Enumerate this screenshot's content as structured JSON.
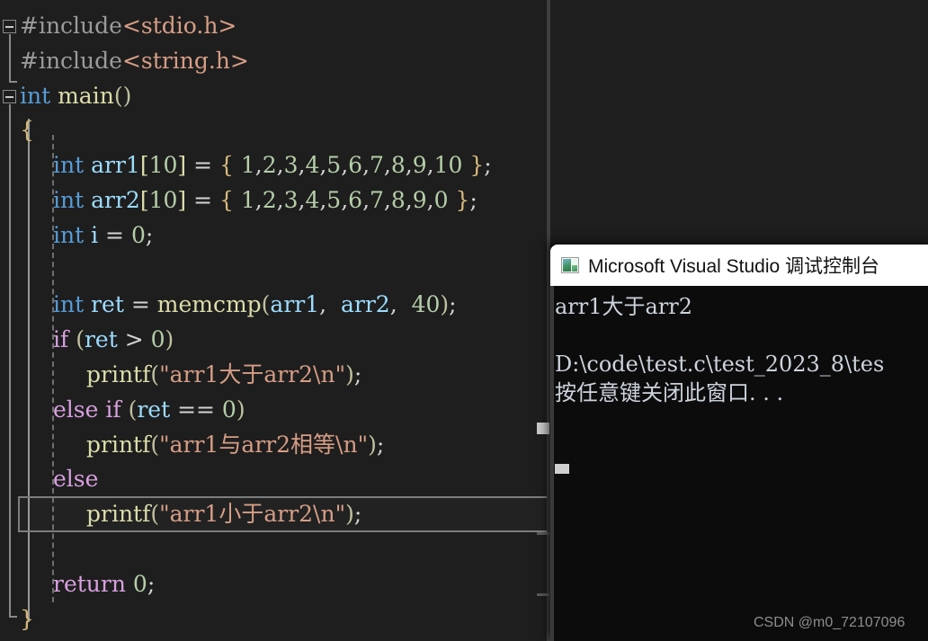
{
  "editor": {
    "language": "c",
    "background_color": "#1e1e1e",
    "highlight_border_color": "#7d7d7d",
    "lines": [
      {
        "n": 1,
        "indent": 0,
        "segments": [
          {
            "text": "#include",
            "cls": "t-pre"
          },
          {
            "text": "<stdio.h>",
            "cls": "t-hdr"
          }
        ]
      },
      {
        "n": 2,
        "indent": 0,
        "segments": [
          {
            "text": "#include",
            "cls": "t-pre"
          },
          {
            "text": "<string.h>",
            "cls": "t-hdr"
          }
        ]
      },
      {
        "n": 3,
        "indent": 0,
        "segments": [
          {
            "text": "int ",
            "cls": "t-kw"
          },
          {
            "text": "main",
            "cls": "t-fn"
          },
          {
            "text": "()",
            "cls": "t-paren"
          }
        ]
      },
      {
        "n": 4,
        "indent": 0,
        "segments": [
          {
            "text": "{",
            "cls": "t-brace"
          }
        ]
      },
      {
        "n": 5,
        "indent": 1,
        "segments": [
          {
            "text": "int ",
            "cls": "t-kw"
          },
          {
            "text": "arr1",
            "cls": "t-var"
          },
          {
            "text": "[",
            "cls": "t-brk"
          },
          {
            "text": "10",
            "cls": "t-num"
          },
          {
            "text": "]",
            "cls": "t-brk"
          },
          {
            "text": " = ",
            "cls": "t-pun"
          },
          {
            "text": "{ ",
            "cls": "t-brace"
          },
          {
            "text": "1",
            "cls": "t-num"
          },
          {
            "text": ",",
            "cls": "t-pun"
          },
          {
            "text": "2",
            "cls": "t-num"
          },
          {
            "text": ",",
            "cls": "t-pun"
          },
          {
            "text": "3",
            "cls": "t-num"
          },
          {
            "text": ",",
            "cls": "t-pun"
          },
          {
            "text": "4",
            "cls": "t-num"
          },
          {
            "text": ",",
            "cls": "t-pun"
          },
          {
            "text": "5",
            "cls": "t-num"
          },
          {
            "text": ",",
            "cls": "t-pun"
          },
          {
            "text": "6",
            "cls": "t-num"
          },
          {
            "text": ",",
            "cls": "t-pun"
          },
          {
            "text": "7",
            "cls": "t-num"
          },
          {
            "text": ",",
            "cls": "t-pun"
          },
          {
            "text": "8",
            "cls": "t-num"
          },
          {
            "text": ",",
            "cls": "t-pun"
          },
          {
            "text": "9",
            "cls": "t-num"
          },
          {
            "text": ",",
            "cls": "t-pun"
          },
          {
            "text": "10",
            "cls": "t-num"
          },
          {
            "text": " }",
            "cls": "t-brace"
          },
          {
            "text": ";",
            "cls": "t-pun"
          }
        ]
      },
      {
        "n": 6,
        "indent": 1,
        "segments": [
          {
            "text": "int ",
            "cls": "t-kw"
          },
          {
            "text": "arr2",
            "cls": "t-var"
          },
          {
            "text": "[",
            "cls": "t-brk"
          },
          {
            "text": "10",
            "cls": "t-num"
          },
          {
            "text": "]",
            "cls": "t-brk"
          },
          {
            "text": " = ",
            "cls": "t-pun"
          },
          {
            "text": "{ ",
            "cls": "t-brace"
          },
          {
            "text": "1",
            "cls": "t-num"
          },
          {
            "text": ",",
            "cls": "t-pun"
          },
          {
            "text": "2",
            "cls": "t-num"
          },
          {
            "text": ",",
            "cls": "t-pun"
          },
          {
            "text": "3",
            "cls": "t-num"
          },
          {
            "text": ",",
            "cls": "t-pun"
          },
          {
            "text": "4",
            "cls": "t-num"
          },
          {
            "text": ",",
            "cls": "t-pun"
          },
          {
            "text": "5",
            "cls": "t-num"
          },
          {
            "text": ",",
            "cls": "t-pun"
          },
          {
            "text": "6",
            "cls": "t-num"
          },
          {
            "text": ",",
            "cls": "t-pun"
          },
          {
            "text": "7",
            "cls": "t-num"
          },
          {
            "text": ",",
            "cls": "t-pun"
          },
          {
            "text": "8",
            "cls": "t-num"
          },
          {
            "text": ",",
            "cls": "t-pun"
          },
          {
            "text": "9",
            "cls": "t-num"
          },
          {
            "text": ",",
            "cls": "t-pun"
          },
          {
            "text": "0",
            "cls": "t-num"
          },
          {
            "text": " }",
            "cls": "t-brace"
          },
          {
            "text": ";",
            "cls": "t-pun"
          }
        ]
      },
      {
        "n": 7,
        "indent": 1,
        "segments": [
          {
            "text": "int ",
            "cls": "t-kw"
          },
          {
            "text": "i",
            "cls": "t-var"
          },
          {
            "text": " = ",
            "cls": "t-pun"
          },
          {
            "text": "0",
            "cls": "t-num"
          },
          {
            "text": ";",
            "cls": "t-pun"
          }
        ]
      },
      {
        "n": 8,
        "indent": 1,
        "segments": []
      },
      {
        "n": 9,
        "indent": 1,
        "segments": [
          {
            "text": "int ",
            "cls": "t-kw"
          },
          {
            "text": "ret",
            "cls": "t-var"
          },
          {
            "text": " = ",
            "cls": "t-pun"
          },
          {
            "text": "memcmp",
            "cls": "t-fn"
          },
          {
            "text": "(",
            "cls": "t-paren"
          },
          {
            "text": "arr1",
            "cls": "t-var"
          },
          {
            "text": ", ",
            "cls": "t-pun"
          },
          {
            "text": " arr2",
            "cls": "t-var"
          },
          {
            "text": ", ",
            "cls": "t-pun"
          },
          {
            "text": " ",
            "cls": "t-pun"
          },
          {
            "text": "40",
            "cls": "t-num"
          },
          {
            "text": ")",
            "cls": "t-paren"
          },
          {
            "text": ";",
            "cls": "t-pun"
          }
        ]
      },
      {
        "n": 10,
        "indent": 1,
        "segments": [
          {
            "text": "if ",
            "cls": "t-ctl"
          },
          {
            "text": "(",
            "cls": "t-paren"
          },
          {
            "text": "ret",
            "cls": "t-var"
          },
          {
            "text": " > ",
            "cls": "t-pun"
          },
          {
            "text": "0",
            "cls": "t-num"
          },
          {
            "text": ")",
            "cls": "t-paren"
          }
        ]
      },
      {
        "n": 11,
        "indent": 2,
        "segments": [
          {
            "text": "printf",
            "cls": "t-fn"
          },
          {
            "text": "(",
            "cls": "t-paren"
          },
          {
            "text": "\"arr1大于arr2\\n\"",
            "cls": "t-str"
          },
          {
            "text": ")",
            "cls": "t-paren"
          },
          {
            "text": ";",
            "cls": "t-pun"
          }
        ]
      },
      {
        "n": 12,
        "indent": 1,
        "segments": [
          {
            "text": "else if ",
            "cls": "t-ctl"
          },
          {
            "text": "(",
            "cls": "t-paren"
          },
          {
            "text": "ret",
            "cls": "t-var"
          },
          {
            "text": " == ",
            "cls": "t-pun"
          },
          {
            "text": "0",
            "cls": "t-num"
          },
          {
            "text": ")",
            "cls": "t-paren"
          }
        ]
      },
      {
        "n": 13,
        "indent": 2,
        "segments": [
          {
            "text": "printf",
            "cls": "t-fn"
          },
          {
            "text": "(",
            "cls": "t-paren"
          },
          {
            "text": "\"arr1与arr2相等\\n\"",
            "cls": "t-str"
          },
          {
            "text": ")",
            "cls": "t-paren"
          },
          {
            "text": ";",
            "cls": "t-pun"
          }
        ]
      },
      {
        "n": 14,
        "indent": 1,
        "segments": [
          {
            "text": "else",
            "cls": "t-ctl"
          }
        ]
      },
      {
        "n": 15,
        "indent": 2,
        "highlighted": true,
        "segments": [
          {
            "text": "printf",
            "cls": "t-fn"
          },
          {
            "text": "(",
            "cls": "t-paren"
          },
          {
            "text": "\"arr1小于arr2\\n\"",
            "cls": "t-str"
          },
          {
            "text": ")",
            "cls": "t-paren"
          },
          {
            "text": ";",
            "cls": "t-pun"
          }
        ]
      },
      {
        "n": 16,
        "indent": 1,
        "segments": []
      },
      {
        "n": 17,
        "indent": 1,
        "segments": [
          {
            "text": "return ",
            "cls": "t-ctl"
          },
          {
            "text": "0",
            "cls": "t-num"
          },
          {
            "text": ";",
            "cls": "t-pun"
          }
        ]
      },
      {
        "n": 18,
        "indent": 0,
        "segments": [
          {
            "text": "}",
            "cls": "t-brace"
          }
        ]
      }
    ]
  },
  "console": {
    "title": "Microsoft Visual Studio 调试控制台",
    "icon": "console-window-icon",
    "titlebar_color": "#ffffff",
    "background_color": "#0c0c0c",
    "text_color": "#ccd3dc",
    "output_lines": [
      "arr1大于arr2",
      "",
      "D:\\code\\test.c\\test_2023_8\\tes",
      "按任意键关闭此窗口. . ."
    ]
  },
  "watermark": {
    "text": "CSDN @m0_72107096"
  }
}
